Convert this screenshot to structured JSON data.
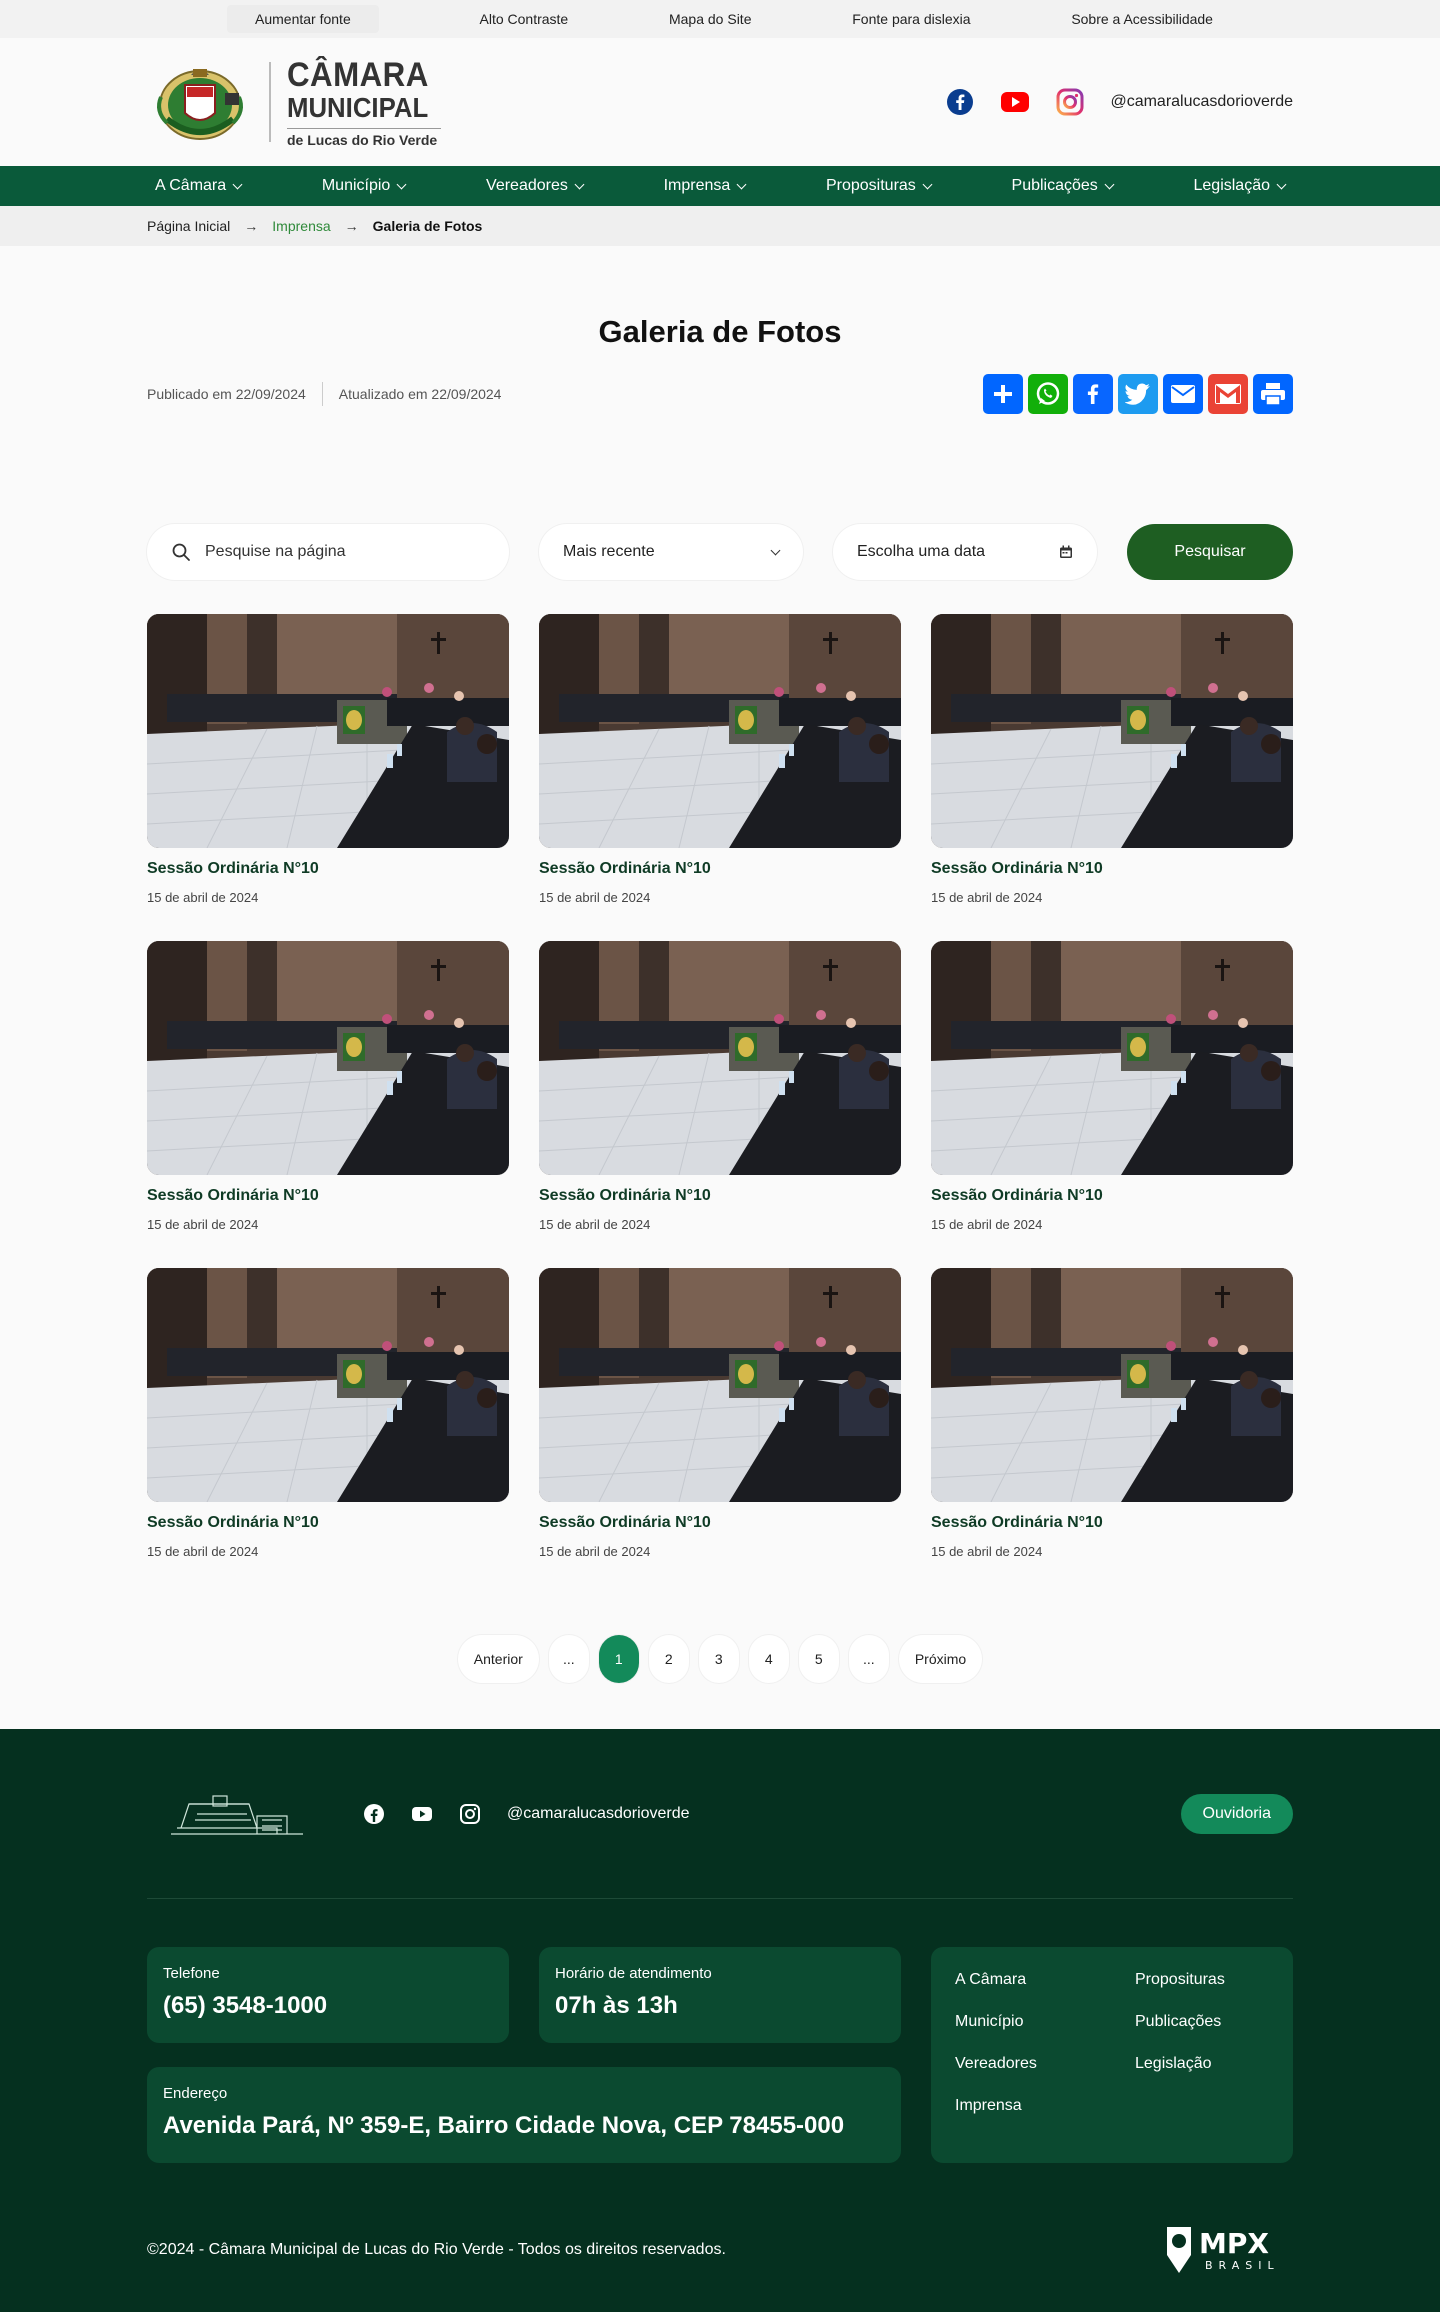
{
  "accessibility": [
    "Aumentar fonte",
    "Alto Contraste",
    "Mapa do Site",
    "Fonte para dislexia",
    "Sobre a Acessibilidade"
  ],
  "logo": {
    "line1": "CÂMARA",
    "line2": "MUNICIPAL",
    "line3": "de Lucas do Rio Verde"
  },
  "header": {
    "social_handle": "@camaralucasdorioverde"
  },
  "nav": [
    "A Câmara",
    "Município",
    "Vereadores",
    "Imprensa",
    "Proposituras",
    "Publicações",
    "Legislação"
  ],
  "breadcrumb": {
    "home": "Página Inicial",
    "section": "Imprensa",
    "current": "Galeria de Fotos"
  },
  "page": {
    "title": "Galeria de Fotos",
    "published": "Publicado em 22/09/2024",
    "updated": "Atualizado em 22/09/2024"
  },
  "share_colors": {
    "add": "#0166ff",
    "whatsapp": "#12af0a",
    "facebook": "#0866ff",
    "twitter": "#1d9bf0",
    "email": "#0166ff",
    "gmail": "#ea4335",
    "print": "#0166ff"
  },
  "filters": {
    "search_placeholder": "Pesquise na página",
    "order": "Mais recente",
    "date_placeholder": "Escolha uma data",
    "submit": "Pesquisar"
  },
  "gallery": [
    {
      "title": "Sessão Ordinária N°10",
      "date": "15 de abril de 2024"
    },
    {
      "title": "Sessão Ordinária N°10",
      "date": "15 de abril de 2024"
    },
    {
      "title": "Sessão Ordinária N°10",
      "date": "15 de abril de 2024"
    },
    {
      "title": "Sessão Ordinária N°10",
      "date": "15 de abril de 2024"
    },
    {
      "title": "Sessão Ordinária N°10",
      "date": "15 de abril de 2024"
    },
    {
      "title": "Sessão Ordinária N°10",
      "date": "15 de abril de 2024"
    },
    {
      "title": "Sessão Ordinária N°10",
      "date": "15 de abril de 2024"
    },
    {
      "title": "Sessão Ordinária N°10",
      "date": "15 de abril de 2024"
    },
    {
      "title": "Sessão Ordinária N°10",
      "date": "15 de abril de 2024"
    }
  ],
  "pagination": {
    "prev": "Anterior",
    "ellipsis": "...",
    "pages": [
      "1",
      "2",
      "3",
      "4",
      "5"
    ],
    "next": "Próximo",
    "current": "1"
  },
  "footer": {
    "social_handle": "@camaralucasdorioverde",
    "ouvidoria": "Ouvidoria",
    "phone_label": "Telefone",
    "phone": "(65) 3548-1000",
    "hours_label": "Horário de atendimento",
    "hours": "07h às 13h",
    "address_label": "Endereço",
    "address": "Avenida Pará, Nº 359-E, Bairro Cidade Nova, CEP 78455-000",
    "links": [
      "A Câmara",
      "Proposituras",
      "Município",
      "Publicações",
      "Vereadores",
      "Legislação",
      "Imprensa"
    ],
    "copyright": "©2024 - Câmara Municipal de Lucas do Rio Verde - Todos os direitos reservados.",
    "brand": "MPX",
    "brand_sub": "BRASIL"
  },
  "colors": {
    "primary": "#0a5a3a",
    "footer_bg": "#05301f",
    "accent": "#138a5a",
    "button": "#1e5e22"
  }
}
